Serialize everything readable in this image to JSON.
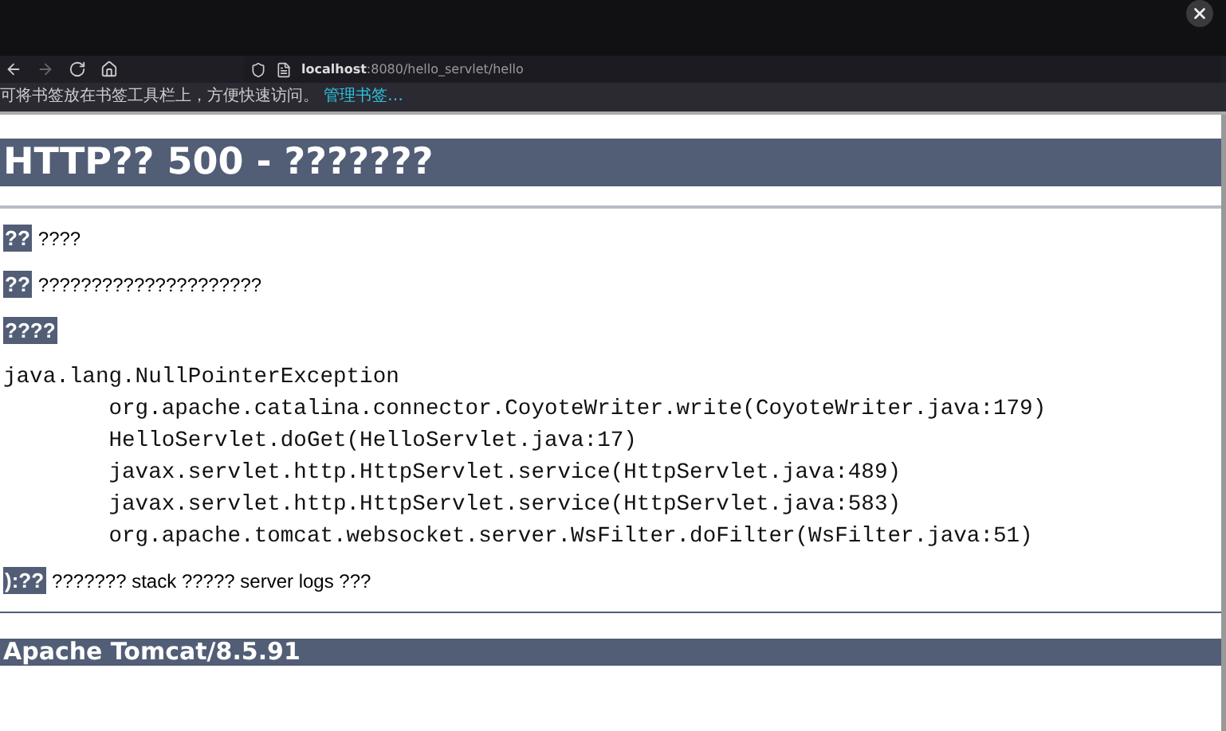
{
  "browser": {
    "url_host": "localhost",
    "url_path": ":8080/hello_servlet/hello",
    "bookmarks_hint": "可将书签放在书签工具栏上，方便快速访问。",
    "bookmarks_link": "管理书签…"
  },
  "page": {
    "title": "HTTP?? 500 - ???????",
    "fields": [
      {
        "label": "??",
        "text": "????"
      },
      {
        "label": "??",
        "text": "?????????????????????"
      }
    ],
    "exception_label": "????",
    "stack": [
      "java.lang.NullPointerException",
      "\torg.apache.catalina.connector.CoyoteWriter.write(CoyoteWriter.java:179)",
      "\tHelloServlet.doGet(HelloServlet.java:17)",
      "\tjavax.servlet.http.HttpServlet.service(HttpServlet.java:489)",
      "\tjavax.servlet.http.HttpServlet.service(HttpServlet.java:583)",
      "\torg.apache.tomcat.websocket.server.WsFilter.doFilter(WsFilter.java:51)"
    ],
    "note": {
      "label": "):??",
      "text": "??????? stack ????? server logs ???"
    },
    "footer": "Apache Tomcat/8.5.91"
  }
}
